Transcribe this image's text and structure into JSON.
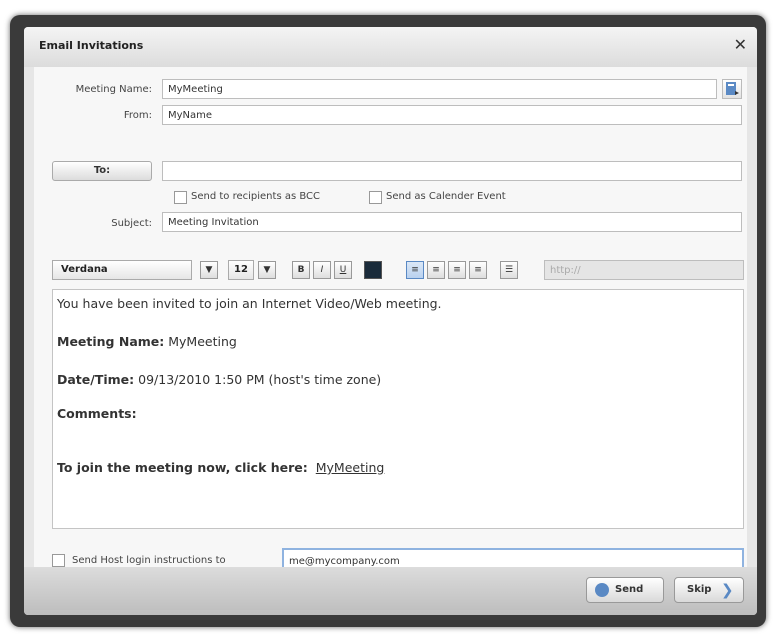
{
  "dialog": {
    "title": "Email Invitations",
    "close_icon": "✕"
  },
  "form": {
    "meeting_name_label": "Meeting Name:",
    "meeting_name_value": "MyMeeting",
    "from_label": "From:",
    "from_value": "MyName",
    "to_button": "To:",
    "to_value": "",
    "bcc_label": "Send to recipients as BCC",
    "calendar_label": "Send as Calender Event",
    "subject_label": "Subject:",
    "subject_value": "Meeting Invitation"
  },
  "toolbar": {
    "font": "Verdana",
    "size": "12",
    "bold": "B",
    "italic": "I",
    "underline": "U",
    "url_placeholder": "http://",
    "icons": [
      "dropdown-arrow-icon",
      "bold-icon",
      "italic-icon",
      "underline-icon",
      "text-color-icon",
      "align-left-icon",
      "align-center-icon",
      "align-right-icon",
      "justify-icon",
      "list-icon"
    ],
    "text_color": "#1a2b3a",
    "accent": "#5a89c4"
  },
  "editor": {
    "intro": "You have been invited to join an Internet Video/Web meeting.",
    "meeting_label": "Meeting Name:",
    "meeting_value": " MyMeeting",
    "datetime_label": "Date/Time:",
    "datetime_value": " 09/13/2010 1:50 PM (host's time zone)",
    "comments_label": "Comments:",
    "join_label": "To join the meeting now, click here:",
    "join_link": "MyMeeting"
  },
  "host": {
    "label": "Send Host login instructions to",
    "email": "me@mycompany.com"
  },
  "buttons": {
    "send": "Send",
    "skip": "Skip"
  }
}
